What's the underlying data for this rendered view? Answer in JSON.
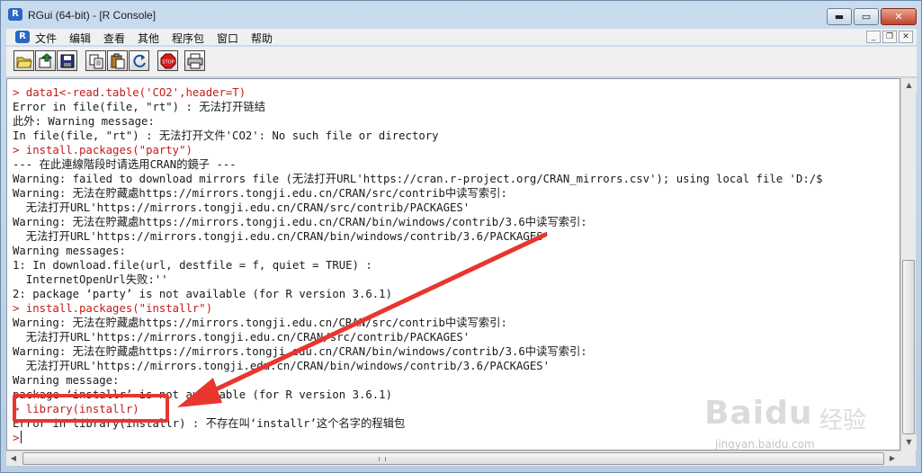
{
  "window": {
    "title": "RGui (64-bit) - [R Console]",
    "app_icon_letter": "R",
    "controls": {
      "minimize": "▬",
      "maximize": "▭",
      "close": "✕"
    }
  },
  "menubar": {
    "items": [
      "文件",
      "编辑",
      "查看",
      "其他",
      "程序包",
      "窗口",
      "帮助"
    ],
    "mdi_controls": {
      "minimize": "_",
      "restore": "❐",
      "close": "✕"
    }
  },
  "toolbar": {
    "buttons": [
      "open-script",
      "load-workspace",
      "save-workspace",
      "copy",
      "paste",
      "copy-paste",
      "stop",
      "print"
    ]
  },
  "console": {
    "lines": [
      {
        "kind": "cmd",
        "text": "> data1<-read.table('CO2',header=T)"
      },
      {
        "kind": "out",
        "text": "Error in file(file, \"rt\") : 无法打开链结"
      },
      {
        "kind": "out",
        "text": "此外: Warning message:"
      },
      {
        "kind": "out",
        "text": "In file(file, \"rt\") : 无法打开文件'CO2': No such file or directory"
      },
      {
        "kind": "cmd",
        "text": "> install.packages(\"party\")"
      },
      {
        "kind": "out",
        "text": "--- 在此連線階段时请选用CRAN的鏡子 ---"
      },
      {
        "kind": "out",
        "text": "Warning: failed to download mirrors file (无法打开URL'https://cran.r-project.org/CRAN_mirrors.csv'); using local file 'D:/$"
      },
      {
        "kind": "out",
        "text": "Warning: 无法在貯藏處https://mirrors.tongji.edu.cn/CRAN/src/contrib中读写索引:"
      },
      {
        "kind": "out",
        "text": "  无法打开URL'https://mirrors.tongji.edu.cn/CRAN/src/contrib/PACKAGES'"
      },
      {
        "kind": "out",
        "text": "Warning: 无法在貯藏處https://mirrors.tongji.edu.cn/CRAN/bin/windows/contrib/3.6中读写索引:"
      },
      {
        "kind": "out",
        "text": "  无法打开URL'https://mirrors.tongji.edu.cn/CRAN/bin/windows/contrib/3.6/PACKAGES'"
      },
      {
        "kind": "out",
        "text": "Warning messages:"
      },
      {
        "kind": "out",
        "text": "1: In download.file(url, destfile = f, quiet = TRUE) :"
      },
      {
        "kind": "out",
        "text": "  InternetOpenUrl失败:''"
      },
      {
        "kind": "out",
        "text": "2: package ‘party’ is not available (for R version 3.6.1)"
      },
      {
        "kind": "cmd",
        "text": "> install.packages(\"installr\")"
      },
      {
        "kind": "out",
        "text": "Warning: 无法在貯藏處https://mirrors.tongji.edu.cn/CRAN/src/contrib中读写索引:"
      },
      {
        "kind": "out",
        "text": "  无法打开URL'https://mirrors.tongji.edu.cn/CRAN/src/contrib/PACKAGES'"
      },
      {
        "kind": "out",
        "text": "Warning: 无法在貯藏處https://mirrors.tongji.edu.cn/CRAN/bin/windows/contrib/3.6中读写索引:"
      },
      {
        "kind": "out",
        "text": "  无法打开URL'https://mirrors.tongji.edu.cn/CRAN/bin/windows/contrib/3.6/PACKAGES'"
      },
      {
        "kind": "out",
        "text": "Warning message:"
      },
      {
        "kind": "out",
        "text": "package ‘installr’ is not available (for R version 3.6.1)"
      },
      {
        "kind": "cmd",
        "text": "> library(installr)"
      },
      {
        "kind": "out",
        "text": "Error in library(installr) : 不存在叫‘installr’这个名字的程辑包"
      }
    ],
    "prompt": ">"
  },
  "watermark": {
    "logo": "Baidu",
    "label": "经验",
    "url": "jingyan.baidu.com"
  },
  "colors": {
    "command": "#c41a1a",
    "output": "#1a1a1a",
    "annotation": "#e8362f"
  }
}
